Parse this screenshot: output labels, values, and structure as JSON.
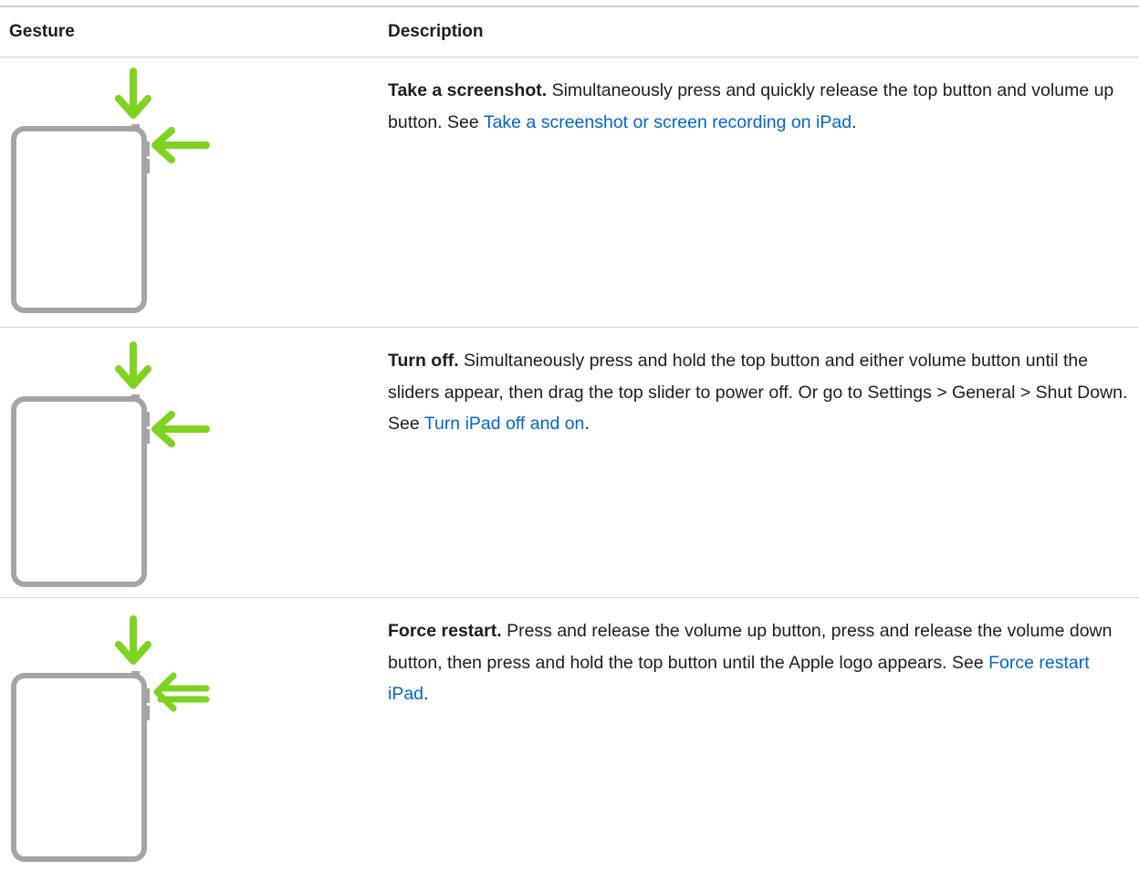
{
  "table": {
    "headers": {
      "gesture": "Gesture",
      "description": "Description"
    },
    "rows": [
      {
        "icon": "ipad-top-and-volume-up-press-icon",
        "lead": "Take a screenshot.",
        "text": "Simultaneously press and quickly release the top button and volume up button. See",
        "link": "Take a screenshot or screen recording on iPad",
        "end": "."
      },
      {
        "icon": "ipad-top-and-volume-hold-icon",
        "lead": "Turn off.",
        "text": "Simultaneously press and hold the top button and either volume button until the sliders appear, then drag the top slider to power off. Or go to Settings > General > Shut Down. See",
        "link": "Turn iPad off and on",
        "end": "."
      },
      {
        "icon": "ipad-force-restart-icon",
        "lead": "Force restart.",
        "text": "Press and release the volume up button, press and release the volume down button, then press and hold the top button until the Apple logo appears. See",
        "link": "Force restart iPad",
        "end": "."
      }
    ]
  },
  "colors": {
    "arrow": "#7ed321",
    "device": "#a5a5a5",
    "link": "#0066cc",
    "rule": "#d2d2d7"
  }
}
